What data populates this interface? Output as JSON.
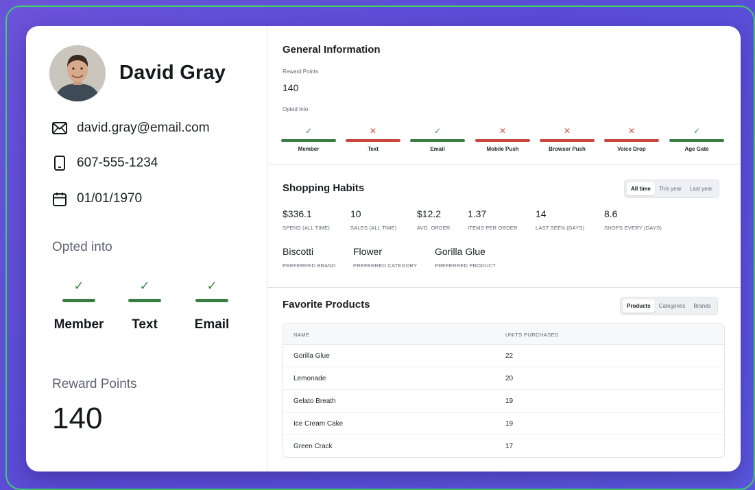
{
  "profile": {
    "name": "David Gray",
    "email": "david.gray@email.com",
    "phone": "607-555-1234",
    "birthdate": "01/01/1970",
    "opted_title": "Opted into",
    "opted": [
      {
        "label": "Member",
        "status": "yes"
      },
      {
        "label": "Text",
        "status": "yes"
      },
      {
        "label": "Email",
        "status": "yes"
      }
    ],
    "points_title": "Reward Points",
    "points": "140"
  },
  "general": {
    "title": "General Information",
    "reward_label": "Reward Points",
    "reward_value": "140",
    "opted_label": "Opted Into",
    "opted": [
      {
        "label": "Member",
        "status": "yes",
        "mark": "✓"
      },
      {
        "label": "Text",
        "status": "no",
        "mark": "✕"
      },
      {
        "label": "Email",
        "status": "yes",
        "mark": "✓"
      },
      {
        "label": "Mobile Push",
        "status": "no",
        "mark": "✕"
      },
      {
        "label": "Browser Push",
        "status": "no",
        "mark": "✕"
      },
      {
        "label": "Voice Drop",
        "status": "no",
        "mark": "✕"
      },
      {
        "label": "Age Gate",
        "status": "yes",
        "mark": "✓"
      }
    ]
  },
  "habits": {
    "title": "Shopping Habits",
    "range_options": [
      "All time",
      "This year",
      "Last year"
    ],
    "range_selected": "All time",
    "stats": [
      {
        "value": "$336.1",
        "label": "SPEND (ALL TIME)"
      },
      {
        "value": "10",
        "label": "SALES (ALL TIME)"
      },
      {
        "value": "$12.2",
        "label": "AVG. ORDER"
      },
      {
        "value": "1.37",
        "label": "ITEMS PER ORDER"
      },
      {
        "value": "14",
        "label": "LAST SEEN (DAYS)"
      },
      {
        "value": "8.6",
        "label": "SHOPS EVERY (DAYS)"
      }
    ],
    "preferences": [
      {
        "value": "Biscotti",
        "label": "PREFERRED BRAND"
      },
      {
        "value": "Flower",
        "label": "PREFERRED CATEGORY"
      },
      {
        "value": "Gorilla Glue",
        "label": "PREFERRED PRODUCT"
      }
    ]
  },
  "favorites": {
    "title": "Favorite Products",
    "tabs": [
      "Products",
      "Categories",
      "Brands"
    ],
    "tab_selected": "Products",
    "columns": [
      "NAME",
      "UNITS PURCHASED"
    ],
    "rows": [
      {
        "name": "Gorilla Glue",
        "units": "22"
      },
      {
        "name": "Lemonade",
        "units": "20"
      },
      {
        "name": "Gelato Breath",
        "units": "19"
      },
      {
        "name": "Ice Cream Cake",
        "units": "19"
      },
      {
        "name": "Green Crack",
        "units": "17"
      }
    ]
  },
  "colors": {
    "background": "#5d4fd9",
    "frame": "#3fd06a",
    "opt_in": "#3a7d44",
    "opt_out": "#c9463d"
  },
  "icons": [
    "mail-icon",
    "phone-icon",
    "calendar-icon",
    "check-icon",
    "x-icon"
  ]
}
